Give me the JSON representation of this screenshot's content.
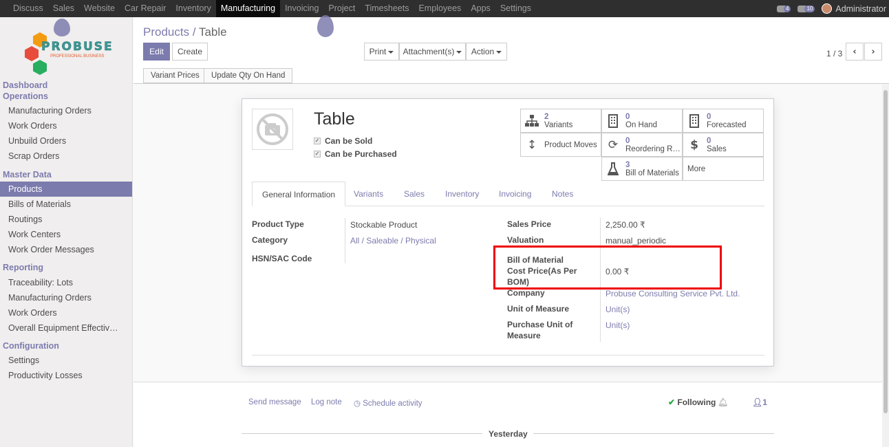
{
  "topbar": {
    "menu": [
      "Discuss",
      "Sales",
      "Website",
      "Car Repair",
      "Inventory",
      "Manufacturing",
      "Invoicing",
      "Project",
      "Timesheets",
      "Employees",
      "Apps",
      "Settings"
    ],
    "active": "Manufacturing",
    "messages_count": "4",
    "activities_count": "10",
    "user": "Administrator"
  },
  "logo": {
    "brand": "PROBUSE",
    "tagline": "PROFESSIONAL BUSINESS"
  },
  "sidebar": {
    "dashboard": "Dashboard",
    "operations": "Operations",
    "operations_items": [
      "Manufacturing Orders",
      "Work Orders",
      "Unbuild Orders",
      "Scrap Orders"
    ],
    "master_data": "Master Data",
    "master_items": [
      "Products",
      "Bills of Materials",
      "Routings",
      "Work Centers",
      "Work Order Messages"
    ],
    "reporting": "Reporting",
    "reporting_items": [
      "Traceability: Lots",
      "Manufacturing Orders",
      "Work Orders",
      "Overall Equipment Effectiv…"
    ],
    "configuration": "Configuration",
    "configuration_items": [
      "Settings",
      "Productivity Losses"
    ]
  },
  "breadcrumb": {
    "parent": "Products",
    "sep": " / ",
    "current": "Table"
  },
  "buttons": {
    "edit": "Edit",
    "create": "Create",
    "print": "Print",
    "attachments": "Attachment(s)",
    "action": "Action"
  },
  "pager": {
    "value": "1 / 3",
    "prev": "‹",
    "next": "›"
  },
  "header_buttons": {
    "variant_prices": "Variant Prices",
    "update_qty": "Update Qty On Hand"
  },
  "product": {
    "name": "Table",
    "can_be_sold": "Can be Sold",
    "can_be_purchased": "Can be Purchased"
  },
  "smart_buttons": {
    "variants": {
      "num": "2",
      "label": "Variants"
    },
    "on_hand": {
      "num": "0",
      "label": "On Hand"
    },
    "forecasted": {
      "num": "0",
      "label": "Forecasted"
    },
    "product_moves": {
      "label": "Product Moves"
    },
    "reordering": {
      "num": "0",
      "label": "Reordering R…"
    },
    "sales": {
      "num": "0",
      "label": "Sales"
    },
    "bom": {
      "num": "3",
      "label": "Bill of Materials"
    },
    "more": {
      "label": "More"
    }
  },
  "tabs": [
    "General Information",
    "Variants",
    "Sales",
    "Inventory",
    "Invoicing",
    "Notes"
  ],
  "fields": {
    "product_type": {
      "label": "Product Type",
      "value": "Stockable Product"
    },
    "category": {
      "label": "Category",
      "value": "All / Saleable / Physical"
    },
    "hsn": {
      "label": "HSN/SAC Code",
      "value": ""
    },
    "sales_price": {
      "label": "Sales Price",
      "value": "2,250.00 ₹"
    },
    "valuation": {
      "label": "Valuation",
      "value": "manual_periodic"
    },
    "bom_cost_1": "Bill of Material",
    "bom_cost_2": "Cost Price(As Per",
    "bom_cost_3": "BOM)",
    "bom_cost_value": "0.00 ₹",
    "company": {
      "label": "Company",
      "value": "Probuse Consulting Service Pvt. Ltd."
    },
    "uom": {
      "label": "Unit of Measure",
      "value": "Unit(s)"
    },
    "purchase_uom_1": "Purchase Unit of",
    "purchase_uom_2": "Measure",
    "purchase_uom_value": "Unit(s)"
  },
  "chatter": {
    "send_message": "Send message",
    "log_note": "Log note",
    "schedule_activity": "Schedule activity",
    "following": "Following",
    "followers": "1",
    "yesterday": "Yesterday"
  },
  "colors": {
    "accent": "#7c7bad",
    "topbar": "#2f2f2f",
    "highlight": "#ee0000"
  }
}
